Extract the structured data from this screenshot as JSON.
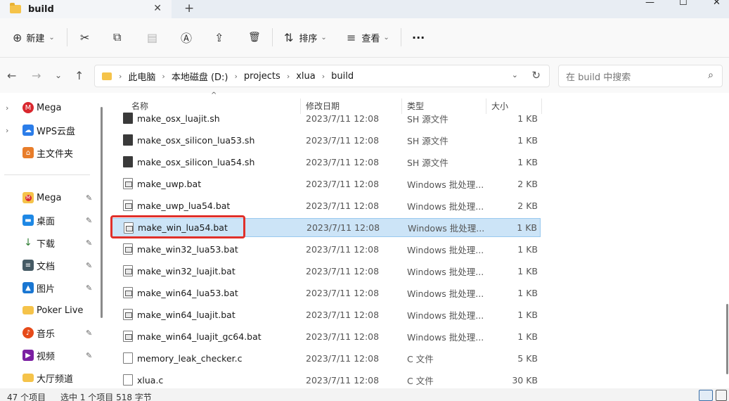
{
  "tab": {
    "title": "build",
    "close": "✕",
    "new_tab": "+"
  },
  "window_controls": {
    "minimize": "—",
    "maximize": "☐",
    "close": "✕"
  },
  "commands": {
    "new_icon": "⊕",
    "new_label": "新建",
    "cut_icon": "✂",
    "copy_icon": "⧉",
    "paste_icon": "▤",
    "rename_icon": "Ⓐ",
    "share_icon": "⇪",
    "delete_icon": "🗑",
    "sort_icon": "⇅",
    "sort_label": "排序",
    "view_icon": "≡",
    "view_label": "查看",
    "more": "···"
  },
  "nav": {
    "back": "←",
    "forward": "→",
    "dropdown": "⌄",
    "up": "↑"
  },
  "breadcrumbs": [
    "此电脑",
    "本地磁盘 (D:)",
    "projects",
    "xlua",
    "build"
  ],
  "search": {
    "placeholder": "在 build 中搜索",
    "icon": "⌕"
  },
  "sidebar": {
    "items": [
      {
        "label": "Mega",
        "icon": "mega-icon",
        "color": "#d9272e",
        "glyph": "M",
        "expand": "›"
      },
      {
        "label": "WPS云盘",
        "icon": "cloud-icon",
        "color": "#2b7de9",
        "glyph": "☁",
        "expand": "›"
      },
      {
        "label": "主文件夹",
        "icon": "home-icon",
        "color": "#e87d2a",
        "glyph": "⌂",
        "expand": ""
      },
      {
        "label": "Mega",
        "icon": "mega-icon",
        "color": "#d9272e",
        "glyph": "M",
        "pin": "📌"
      },
      {
        "label": "桌面",
        "icon": "desktop-icon",
        "color": "#1e88e5",
        "glyph": "▬",
        "pin": "📌"
      },
      {
        "label": "下载",
        "icon": "download-icon",
        "color": "#2e7d32",
        "glyph": "↓",
        "pin": "📌"
      },
      {
        "label": "文档",
        "icon": "documents-icon",
        "color": "#455a64",
        "glyph": "≡",
        "pin": "📌"
      },
      {
        "label": "图片",
        "icon": "pictures-icon",
        "color": "#1976d2",
        "glyph": "▲",
        "pin": "📌"
      },
      {
        "label": "Poker Live",
        "icon": "folder-icon",
        "color": "#f5c34a",
        "glyph": "",
        "pin": ""
      },
      {
        "label": "音乐",
        "icon": "music-icon",
        "color": "#e64a19",
        "glyph": "♪",
        "pin": "📌"
      },
      {
        "label": "视频",
        "icon": "video-icon",
        "color": "#7b1fa2",
        "glyph": "▶",
        "pin": "📌"
      },
      {
        "label": "大厅频道",
        "icon": "folder-icon",
        "color": "#f5c34a",
        "glyph": "",
        "pin": ""
      }
    ]
  },
  "columns": {
    "name": "名称",
    "date": "修改日期",
    "type": "类型",
    "size": "大小",
    "sort_arrow": "^"
  },
  "files": [
    {
      "name": "make_osx_luajit.sh",
      "date": "2023/7/11 12:08",
      "type": "SH 源文件",
      "size": "1 KB",
      "icon": "sh"
    },
    {
      "name": "make_osx_silicon_lua53.sh",
      "date": "2023/7/11 12:08",
      "type": "SH 源文件",
      "size": "1 KB",
      "icon": "sh"
    },
    {
      "name": "make_osx_silicon_lua54.sh",
      "date": "2023/7/11 12:08",
      "type": "SH 源文件",
      "size": "1 KB",
      "icon": "sh"
    },
    {
      "name": "make_uwp.bat",
      "date": "2023/7/11 12:08",
      "type": "Windows 批处理...",
      "size": "2 KB",
      "icon": "bat"
    },
    {
      "name": "make_uwp_lua54.bat",
      "date": "2023/7/11 12:08",
      "type": "Windows 批处理...",
      "size": "2 KB",
      "icon": "bat"
    },
    {
      "name": "make_win_lua54.bat",
      "date": "2023/7/11 12:08",
      "type": "Windows 批处理...",
      "size": "1 KB",
      "icon": "bat",
      "selected": true
    },
    {
      "name": "make_win32_lua53.bat",
      "date": "2023/7/11 12:08",
      "type": "Windows 批处理...",
      "size": "1 KB",
      "icon": "bat"
    },
    {
      "name": "make_win32_luajit.bat",
      "date": "2023/7/11 12:08",
      "type": "Windows 批处理...",
      "size": "1 KB",
      "icon": "bat"
    },
    {
      "name": "make_win64_lua53.bat",
      "date": "2023/7/11 12:08",
      "type": "Windows 批处理...",
      "size": "1 KB",
      "icon": "bat"
    },
    {
      "name": "make_win64_luajit.bat",
      "date": "2023/7/11 12:08",
      "type": "Windows 批处理...",
      "size": "1 KB",
      "icon": "bat"
    },
    {
      "name": "make_win64_luajit_gc64.bat",
      "date": "2023/7/11 12:08",
      "type": "Windows 批处理...",
      "size": "1 KB",
      "icon": "bat"
    },
    {
      "name": "memory_leak_checker.c",
      "date": "2023/7/11 12:08",
      "type": "C 文件",
      "size": "5 KB",
      "icon": "c"
    },
    {
      "name": "xlua.c",
      "date": "2023/7/11 12:08",
      "type": "C 文件",
      "size": "30 KB",
      "icon": "c"
    }
  ],
  "status": {
    "count": "47 个项目",
    "selection": "选中 1 个项目  518 字节"
  },
  "colors": {
    "selection_bg": "#cce4f7",
    "highlight_border": "#e0302a",
    "folder": "#f5c34a"
  }
}
